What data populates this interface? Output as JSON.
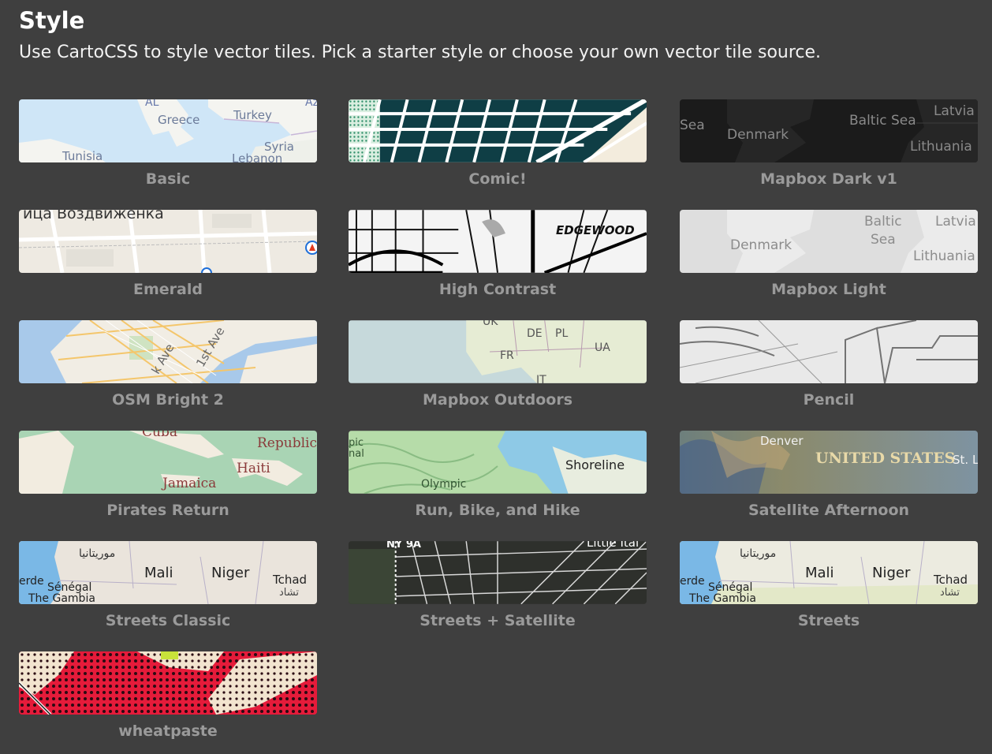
{
  "header": {
    "title": "Style",
    "subtitle": "Use CartoCSS to style vector tiles. Pick a starter style or choose your own vector tile source."
  },
  "styles": [
    {
      "name": "Basic",
      "thumb_labels": [
        "AL",
        "Greece",
        "Turkey",
        "Syria",
        "Tunisia",
        "Lebanon",
        "Az"
      ]
    },
    {
      "name": "Comic!",
      "thumb_labels": []
    },
    {
      "name": "Mapbox Dark v1",
      "thumb_labels": [
        "Sea",
        "Denmark",
        "Baltic Sea",
        "Latvia",
        "Lithuania"
      ]
    },
    {
      "name": "Emerald",
      "thumb_labels": [
        "ица Воздвиженка"
      ]
    },
    {
      "name": "High Contrast",
      "thumb_labels": [
        "EDGEWOOD"
      ]
    },
    {
      "name": "Mapbox Light",
      "thumb_labels": [
        "Baltic",
        "Sea",
        "Latvia",
        "Denmark",
        "Lithuania"
      ]
    },
    {
      "name": "OSM Bright 2",
      "thumb_labels": [
        "1st Ave",
        "k Ave"
      ]
    },
    {
      "name": "Mapbox Outdoors",
      "thumb_labels": [
        "UK",
        "DE",
        "PL",
        "UA",
        "FR",
        "IT"
      ]
    },
    {
      "name": "Pencil",
      "thumb_labels": []
    },
    {
      "name": "Pirates Return",
      "thumb_labels": [
        "Cuba",
        "Republic",
        "Haiti",
        "Jamaica"
      ]
    },
    {
      "name": "Run, Bike, and Hike",
      "thumb_labels": [
        "Shoreline",
        "Olympic",
        "pic",
        "nal"
      ]
    },
    {
      "name": "Satellite Afternoon",
      "thumb_labels": [
        "Denver",
        "UNITED STATES",
        "St. Lo"
      ]
    },
    {
      "name": "Streets Classic",
      "thumb_labels": [
        "موريتانيا",
        "Mali",
        "Niger",
        "Tchad",
        "تشاد",
        "erde",
        "Sénégal",
        "The Gambia"
      ]
    },
    {
      "name": "Streets + Satellite",
      "thumb_labels": [
        "NY 9A",
        "Little Ital"
      ]
    },
    {
      "name": "Streets",
      "thumb_labels": [
        "موريتانيا",
        "Mali",
        "Niger",
        "Tchad",
        "تشاد",
        "erde",
        "Sénégal",
        "The Gambia"
      ]
    },
    {
      "name": "wheatpaste",
      "thumb_labels": []
    }
  ]
}
